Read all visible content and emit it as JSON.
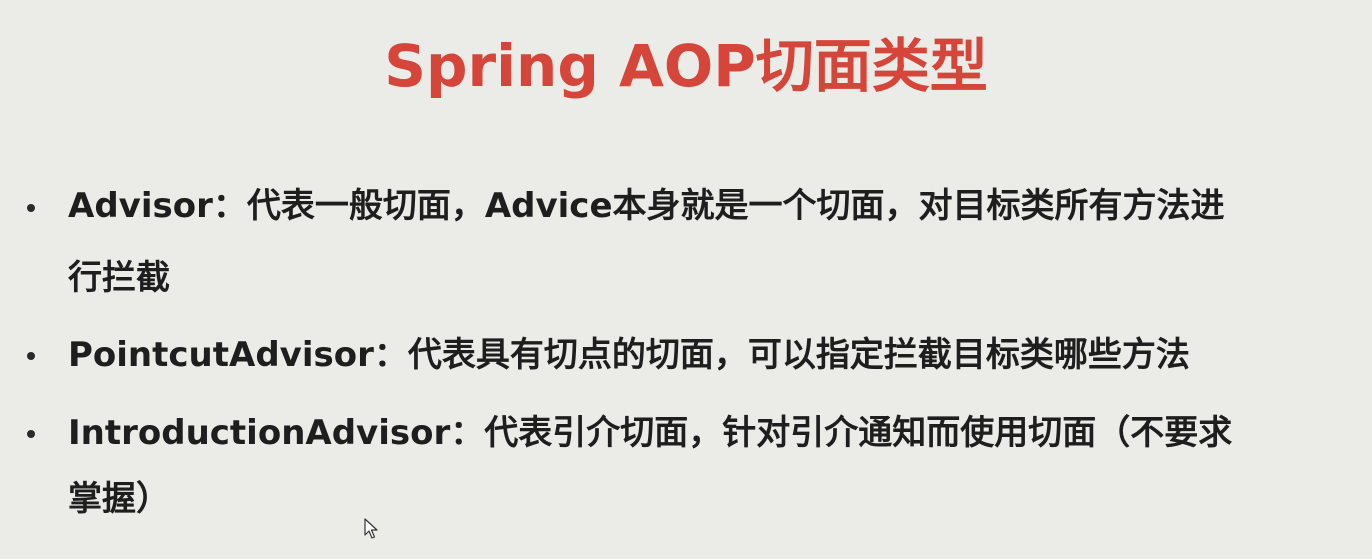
{
  "slide": {
    "title": "Spring AOP切面类型",
    "bullets": [
      {
        "line1": "Advisor：代表一般切面，Advice本身就是一个切面，对目标类所有方法进",
        "line2": "行拦截"
      },
      {
        "line1": "PointcutAdvisor：代表具有切点的切面，可以指定拦截目标类哪些方法"
      },
      {
        "line1": "IntroductionAdvisor：代表引介切面，针对引介通知而使用切面（不要求",
        "line2": "掌握）"
      }
    ]
  },
  "colors": {
    "background": "#ebebe7",
    "title": "#d6453a",
    "text": "#1e1e1e"
  },
  "icons": {
    "cursor": "mouse-pointer-icon"
  }
}
